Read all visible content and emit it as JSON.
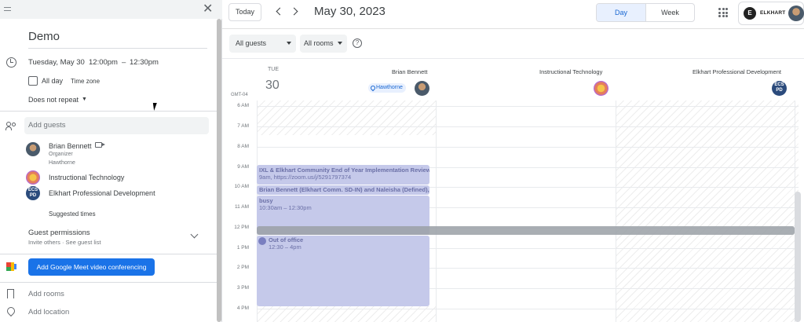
{
  "editor": {
    "title": "Demo",
    "date": "Tuesday, May 30",
    "time_start": "12:00pm",
    "time_dash": "–",
    "time_end": "12:30pm",
    "all_day_label": "All day",
    "time_zone_label": "Time zone",
    "repeat_label": "Does not repeat",
    "add_guests_placeholder": "Add guests",
    "guests": [
      {
        "name": "Brian Bennett",
        "sub1": "Organizer",
        "sub2": "Hawthorne"
      },
      {
        "name": "Instructional Technology"
      },
      {
        "name": "Elkhart Professional Development",
        "avatar_text": "ECS PD"
      }
    ],
    "suggested_times": "Suggested times",
    "guest_permissions": "Guest permissions",
    "guest_permissions_sub": "Invite others · See guest list",
    "meet_button": "Add Google Meet video conferencing",
    "add_rooms": "Add rooms",
    "add_location": "Add location"
  },
  "toolbar": {
    "today": "Today",
    "title": "May 30, 2023",
    "view_day": "Day",
    "view_week": "Week",
    "account_logo": "E",
    "account_name": "ELKHART"
  },
  "filters": {
    "guests": "All guests",
    "rooms": "All rooms",
    "help": "?"
  },
  "calendar": {
    "day_of_week": "TUE",
    "day_number": "30",
    "timezone": "GMT-04",
    "resources": [
      "Brian Bennett",
      "Instructional Technology",
      "Elkhart Professional Development"
    ],
    "location_chip": "Hawthorne",
    "hours": [
      "6 AM",
      "7 AM",
      "8 AM",
      "9 AM",
      "10 AM",
      "11 AM",
      "12 PM",
      "1 PM",
      "2 PM",
      "3 PM",
      "4 PM"
    ],
    "events": [
      {
        "title": "IXL & Elkhart Community End of Year Implementation Review",
        "sub": "9am, https://zoom.us/j/5291797374"
      },
      {
        "title": "Brian Bennett (Elkhart Comm. SD-IN) and Naleisha (Defined),",
        "sub": "busy",
        "time": "10:30am – 12:30pm"
      },
      {
        "title": "Out of office",
        "sub": "12:30 – 4pm"
      }
    ]
  },
  "colors": {
    "primary": "#1a73e8",
    "event_fill": "#c5c9ea",
    "event_text": "#6a6fa6",
    "selected_view": "#e8f0fe"
  }
}
